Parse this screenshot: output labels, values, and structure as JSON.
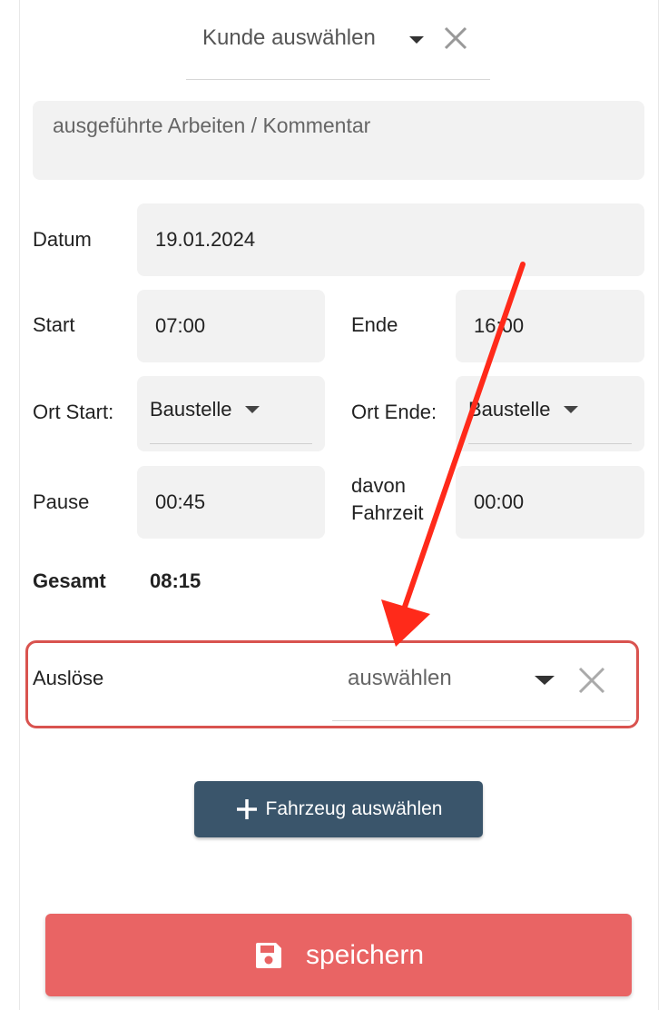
{
  "customer": {
    "placeholder": "Kunde auswählen"
  },
  "comment": {
    "placeholder": "ausgeführte Arbeiten / Kommentar"
  },
  "date": {
    "label": "Datum",
    "value": "19.01.2024"
  },
  "start": {
    "label": "Start",
    "value": "07:00"
  },
  "end": {
    "label": "Ende",
    "value": "16:00"
  },
  "location_start": {
    "label": "Ort Start:",
    "value": "Baustelle"
  },
  "location_end": {
    "label": "Ort Ende:",
    "value": "Baustelle"
  },
  "pause": {
    "label": "Pause",
    "value": "00:45"
  },
  "travel": {
    "label_line1": "davon",
    "label_line2": "Fahrzeit",
    "value": "00:00"
  },
  "total": {
    "label": "Gesamt",
    "value": "08:15"
  },
  "allowance": {
    "label": "Auslöse",
    "placeholder": "auswählen"
  },
  "vehicle_button": {
    "label": "Fahrzeug auswählen"
  },
  "save_button": {
    "label": "speichern"
  },
  "colors": {
    "save": "#e96464",
    "vehicle": "#3a556b",
    "highlight": "#d9534f",
    "annotation_arrow": "#ff2a1a",
    "field_bg": "#f2f2f2"
  },
  "icons": {
    "caret": "chevron-down-icon",
    "clear": "close-icon",
    "plus": "plus-icon",
    "save": "floppy-disk-icon"
  }
}
